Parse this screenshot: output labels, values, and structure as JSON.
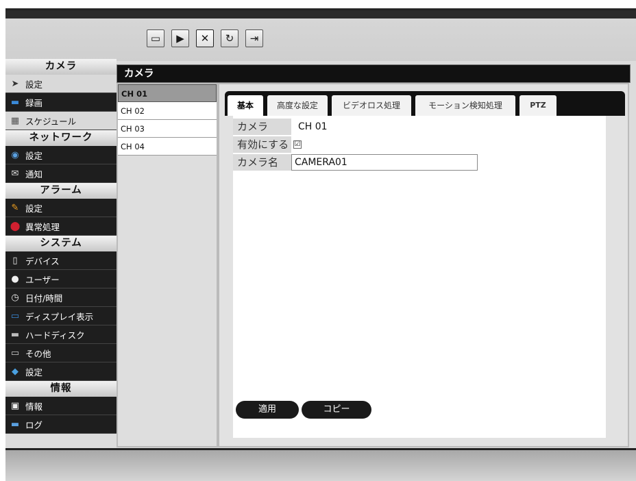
{
  "toolbar": {
    "buttons": [
      {
        "icon": "monitor-icon",
        "glyph": "▭"
      },
      {
        "icon": "playback-icon",
        "glyph": "▶"
      },
      {
        "icon": "tools-icon",
        "glyph": "✕"
      },
      {
        "icon": "refresh-icon",
        "glyph": "↻"
      },
      {
        "icon": "logout-icon",
        "glyph": "⇥"
      }
    ]
  },
  "sidebar": {
    "sections": [
      {
        "title": "カメラ",
        "items": [
          {
            "label": "設定",
            "icon": "camera-settings-icon",
            "glyph": "➤"
          },
          {
            "label": "録画",
            "icon": "recording-icon",
            "glyph": "▬"
          },
          {
            "label": "スケジュール",
            "icon": "calendar-icon",
            "glyph": "▦"
          }
        ]
      },
      {
        "title": "ネットワーク",
        "items": [
          {
            "label": "設定",
            "icon": "network-settings-icon",
            "glyph": "◉"
          },
          {
            "label": "通知",
            "icon": "notification-icon",
            "glyph": "✉"
          }
        ]
      },
      {
        "title": "アラーム",
        "items": [
          {
            "label": "設定",
            "icon": "alarm-settings-icon",
            "glyph": "✎"
          },
          {
            "label": "異常処理",
            "icon": "exception-icon",
            "glyph": "⬤"
          }
        ]
      },
      {
        "title": "システム",
        "items": [
          {
            "label": "デバイス",
            "icon": "device-icon",
            "glyph": "▯"
          },
          {
            "label": "ユーザー",
            "icon": "user-icon",
            "glyph": "●"
          },
          {
            "label": "日付/時間",
            "icon": "clock-icon",
            "glyph": "◷"
          },
          {
            "label": "ディスプレイ表示",
            "icon": "display-icon",
            "glyph": "▭"
          },
          {
            "label": "ハードディスク",
            "icon": "harddisk-icon",
            "glyph": "▬"
          },
          {
            "label": "その他",
            "icon": "other-icon",
            "glyph": "▭"
          },
          {
            "label": "設定",
            "icon": "system-settings-icon",
            "glyph": "◆"
          }
        ]
      },
      {
        "title": "情報",
        "items": [
          {
            "label": "情報",
            "icon": "info-icon",
            "glyph": "▣"
          },
          {
            "label": "ログ",
            "icon": "log-icon",
            "glyph": "▬"
          }
        ]
      }
    ]
  },
  "content": {
    "title": "カメラ",
    "channels": [
      "CH 01",
      "CH 02",
      "CH 03",
      "CH 04"
    ],
    "selected_channel": "CH 01",
    "tabs": [
      "基本",
      "高度な設定",
      "ビデオロス処理",
      "モーション検知処理",
      "PTZ"
    ],
    "active_tab": "基本",
    "form": {
      "camera_label": "カメラ",
      "camera_value": "CH 01",
      "enable_label": "有効にする",
      "enable_checked": "☑",
      "name_label": "カメラ名",
      "name_value": "CAMERA01"
    },
    "buttons": {
      "apply": "適用",
      "copy": "コピー"
    }
  }
}
